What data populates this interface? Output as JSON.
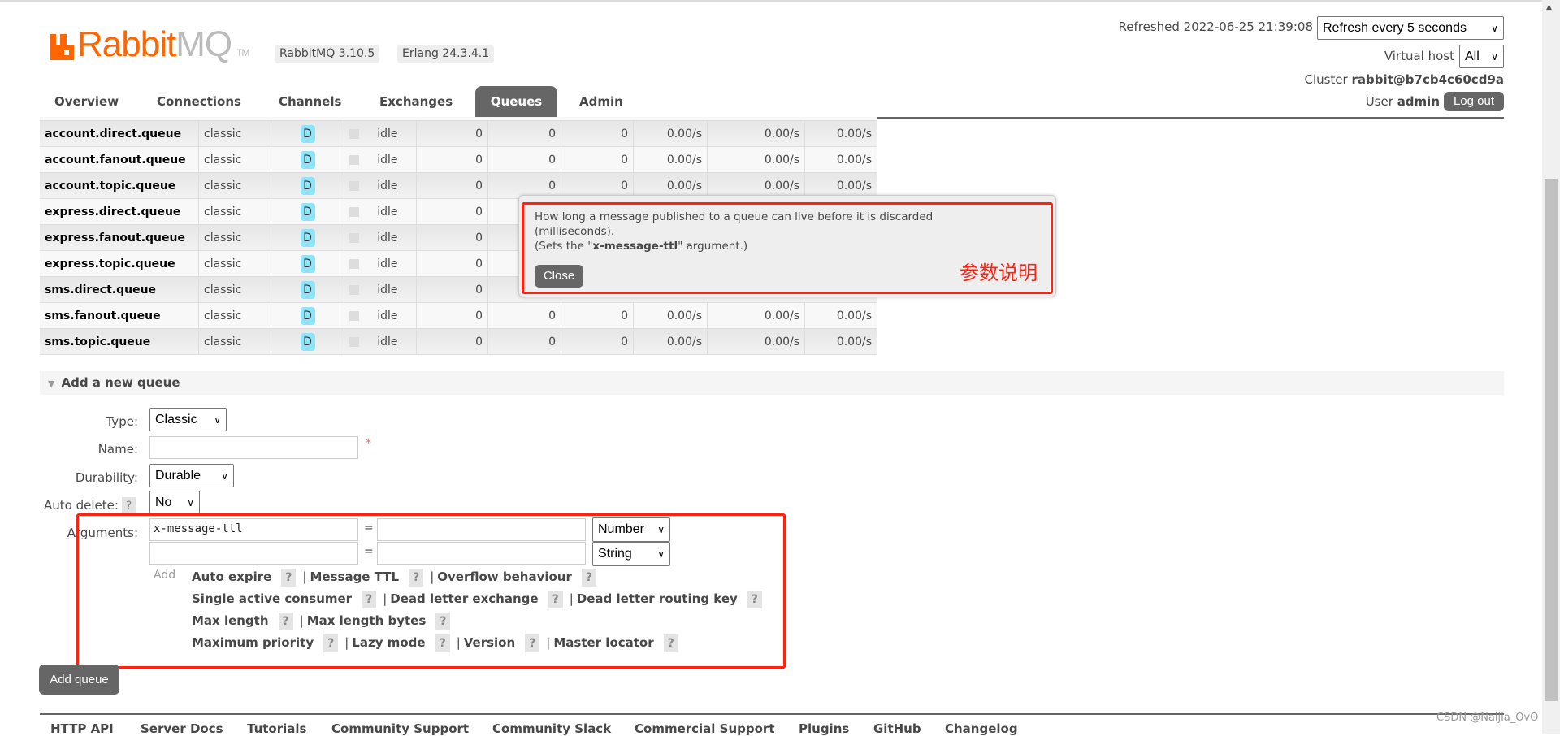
{
  "header": {
    "logo_primary": "Rabbit",
    "logo_secondary": "MQ",
    "logo_tm": "TM",
    "version_badge": "RabbitMQ 3.10.5",
    "erlang_badge": "Erlang 24.3.4.1",
    "refreshed": "Refreshed 2022-06-25 21:39:08",
    "refresh_select": "Refresh every 5 seconds",
    "vhost_label": "Virtual host",
    "vhost_select": "All",
    "cluster_label": "Cluster",
    "cluster_name": "rabbit@b7cb4c60cd9a",
    "user_label": "User",
    "user_name": "admin",
    "logout": "Log out"
  },
  "tabs": [
    {
      "label": "Overview"
    },
    {
      "label": "Connections"
    },
    {
      "label": "Channels"
    },
    {
      "label": "Exchanges"
    },
    {
      "label": "Queues",
      "selected": true
    },
    {
      "label": "Admin"
    }
  ],
  "queues": [
    {
      "name": "account.direct.queue",
      "type": "classic",
      "features": "D",
      "state": "idle",
      "ready": "0",
      "unacked": "0",
      "total": "0",
      "incoming": "0.00/s",
      "deliver": "0.00/s",
      "ack": "0.00/s"
    },
    {
      "name": "account.fanout.queue",
      "type": "classic",
      "features": "D",
      "state": "idle",
      "ready": "0",
      "unacked": "0",
      "total": "0",
      "incoming": "0.00/s",
      "deliver": "0.00/s",
      "ack": "0.00/s"
    },
    {
      "name": "account.topic.queue",
      "type": "classic",
      "features": "D",
      "state": "idle",
      "ready": "0",
      "unacked": "0",
      "total": "0",
      "incoming": "0.00/s",
      "deliver": "0.00/s",
      "ack": "0.00/s"
    },
    {
      "name": "express.direct.queue",
      "type": "classic",
      "features": "D",
      "state": "idle",
      "ready": "0",
      "unacked": "",
      "total": "",
      "incoming": "",
      "deliver": "",
      "ack": ""
    },
    {
      "name": "express.fanout.queue",
      "type": "classic",
      "features": "D",
      "state": "idle",
      "ready": "0",
      "unacked": "",
      "total": "",
      "incoming": "",
      "deliver": "",
      "ack": ""
    },
    {
      "name": "express.topic.queue",
      "type": "classic",
      "features": "D",
      "state": "idle",
      "ready": "0",
      "unacked": "",
      "total": "",
      "incoming": "",
      "deliver": "",
      "ack": ""
    },
    {
      "name": "sms.direct.queue",
      "type": "classic",
      "features": "D",
      "state": "idle",
      "ready": "0",
      "unacked": "",
      "total": "",
      "incoming": "",
      "deliver": "",
      "ack": ""
    },
    {
      "name": "sms.fanout.queue",
      "type": "classic",
      "features": "D",
      "state": "idle",
      "ready": "0",
      "unacked": "0",
      "total": "0",
      "incoming": "0.00/s",
      "deliver": "0.00/s",
      "ack": "0.00/s"
    },
    {
      "name": "sms.topic.queue",
      "type": "classic",
      "features": "D",
      "state": "idle",
      "ready": "0",
      "unacked": "0",
      "total": "0",
      "incoming": "0.00/s",
      "deliver": "0.00/s",
      "ack": "0.00/s"
    }
  ],
  "tooltip": {
    "line1": "How long a message published to a queue can live before it is discarded",
    "line2": "(milliseconds).",
    "line3_pre": "(Sets the \"",
    "line3_bold": "x-message-ttl",
    "line3_post": "\" argument.)",
    "close": "Close",
    "annotation": "参数说明",
    "annotation_color": "#ff2211"
  },
  "add_queue": {
    "section_title": "Add a new queue",
    "type_label": "Type:",
    "type_value": "Classic",
    "name_label": "Name:",
    "name_value": "",
    "required_mark": "*",
    "durability_label": "Durability:",
    "durability_value": "Durable",
    "auto_delete_label": "Auto delete:",
    "help": "?",
    "auto_delete_value": "No",
    "arguments_label": "Arguments:",
    "args": [
      {
        "key": "x-message-ttl",
        "eq": "=",
        "value": "",
        "type": "Number"
      },
      {
        "key": "",
        "eq": "=",
        "value": "",
        "type": "String"
      }
    ],
    "add_label": "Add",
    "sep": "|",
    "arg_links": [
      [
        "Auto expire",
        "Message TTL",
        "Overflow behaviour"
      ],
      [
        "Single active consumer",
        "Dead letter exchange",
        "Dead letter routing key"
      ],
      [
        "Max length",
        "Max length bytes"
      ],
      [
        "Maximum priority",
        "Lazy mode",
        "Version",
        "Master locator"
      ]
    ],
    "submit": "Add queue"
  },
  "footer": {
    "links": [
      "HTTP API",
      "Server Docs",
      "Tutorials",
      "Community Support",
      "Community Slack",
      "Commercial Support",
      "Plugins",
      "GitHub",
      "Changelog"
    ]
  },
  "watermark": "CSDN @Naijia_OvO"
}
